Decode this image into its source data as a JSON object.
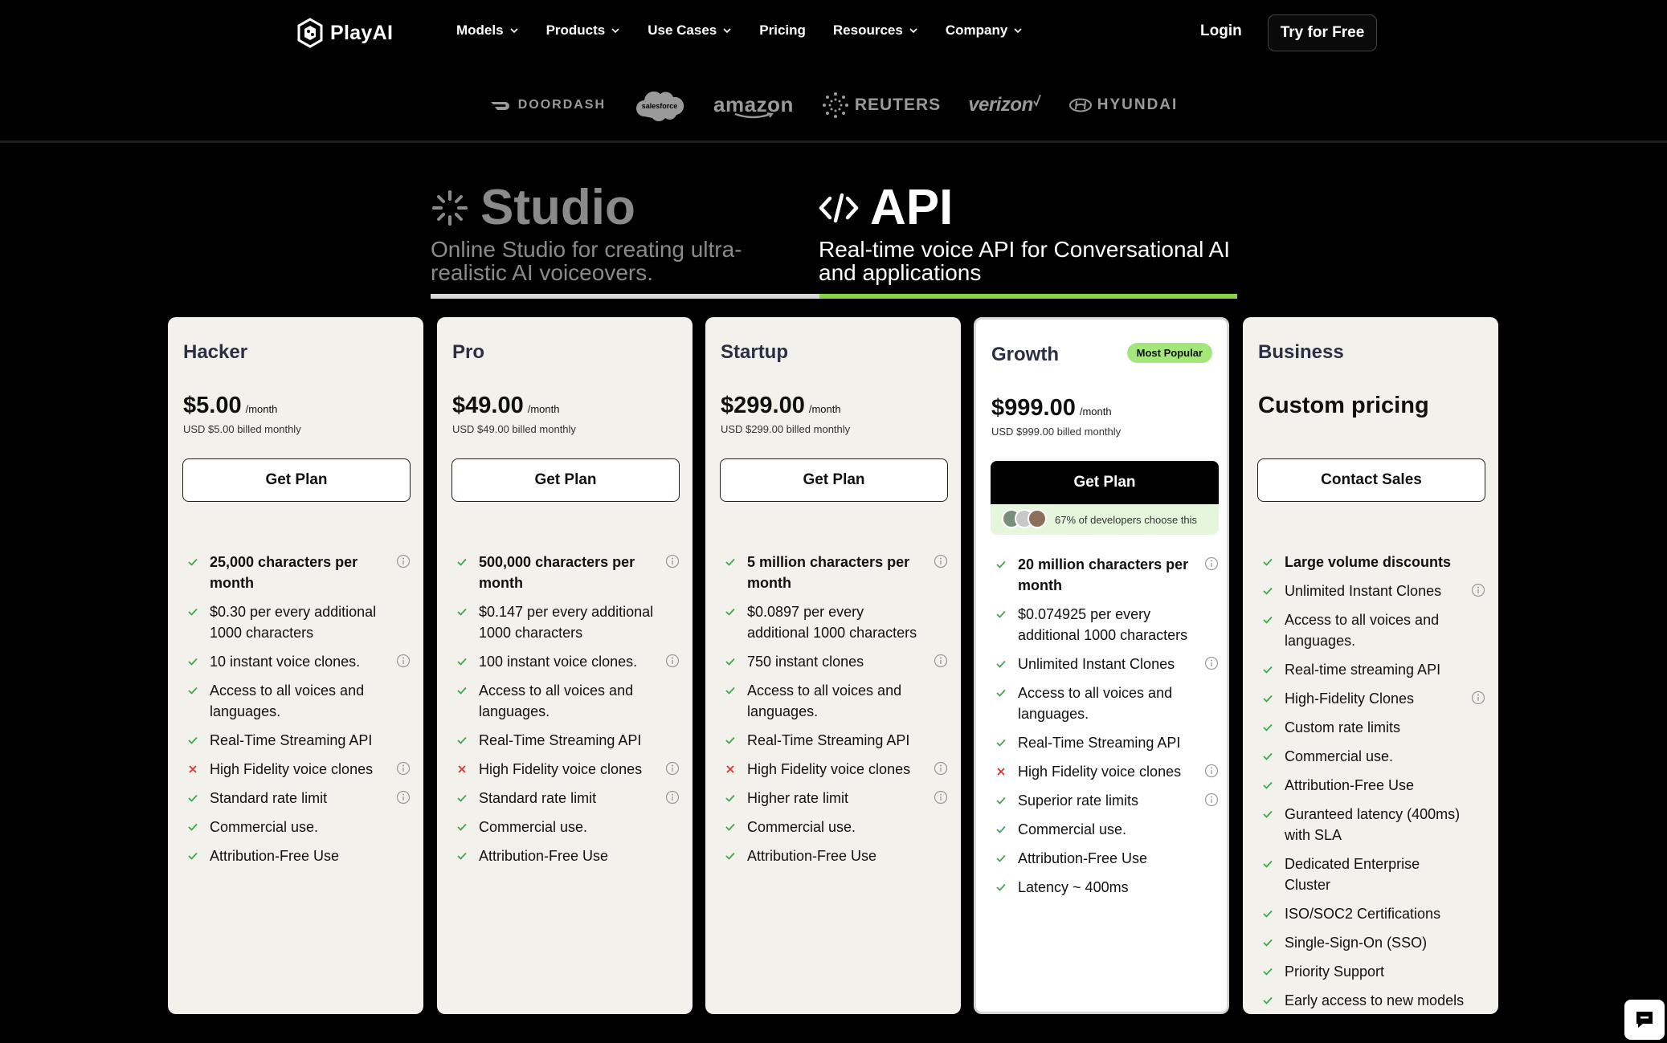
{
  "brand": {
    "name": "PlayAI"
  },
  "nav": {
    "items": [
      {
        "label": "Models",
        "dropdown": true
      },
      {
        "label": "Products",
        "dropdown": true
      },
      {
        "label": "Use Cases",
        "dropdown": true
      },
      {
        "label": "Pricing",
        "dropdown": false
      },
      {
        "label": "Resources",
        "dropdown": true
      },
      {
        "label": "Company",
        "dropdown": true
      }
    ],
    "login": "Login",
    "cta": "Try for Free"
  },
  "logos": {
    "doordash": "DOORDASH",
    "salesforce": "salesforce",
    "amazon": "amazon",
    "reuters": "REUTERS",
    "verizon": "verizon",
    "hyundai": "HYUNDAI"
  },
  "product_tabs": {
    "studio": {
      "title": "Studio",
      "subtitle": "Online Studio for creating ultra-realistic AI voiceovers."
    },
    "api": {
      "title": "API",
      "subtitle": "Real-time voice API for Conversational AI and applications"
    }
  },
  "colors": {
    "accent_green": "#86d34a",
    "badge_green": "#a3e67a",
    "check": "#3ba84a",
    "cross": "#e0322f"
  },
  "plans": [
    {
      "name": "Hacker",
      "price": "$5.00",
      "per": "/month",
      "billed": "USD $5.00 billed monthly",
      "button": "Get Plan",
      "features": [
        {
          "text": "25,000 characters per month",
          "ok": true,
          "info": true,
          "bold": true
        },
        {
          "text": "$0.30 per every additional 1000 characters",
          "ok": true,
          "info": false
        },
        {
          "text": "10 instant voice clones.",
          "ok": true,
          "info": true
        },
        {
          "text": "Access to all voices and languages.",
          "ok": true,
          "info": false
        },
        {
          "text": "Real-Time Streaming API",
          "ok": true,
          "info": false
        },
        {
          "text": "High Fidelity voice clones",
          "ok": false,
          "info": true
        },
        {
          "text": "Standard rate limit",
          "ok": true,
          "info": true
        },
        {
          "text": "Commercial use.",
          "ok": true,
          "info": false
        },
        {
          "text": "Attribution-Free Use",
          "ok": true,
          "info": false
        }
      ]
    },
    {
      "name": "Pro",
      "price": "$49.00",
      "per": "/month",
      "billed": "USD $49.00 billed monthly",
      "button": "Get Plan",
      "features": [
        {
          "text": "500,000 characters per month",
          "ok": true,
          "info": true,
          "bold": true
        },
        {
          "text": "$0.147 per every additional 1000 characters",
          "ok": true,
          "info": false
        },
        {
          "text": "100 instant voice clones.",
          "ok": true,
          "info": true
        },
        {
          "text": "Access to all voices and languages.",
          "ok": true,
          "info": false
        },
        {
          "text": "Real-Time Streaming API",
          "ok": true,
          "info": false
        },
        {
          "text": "High Fidelity voice clones",
          "ok": false,
          "info": true
        },
        {
          "text": "Standard rate limit",
          "ok": true,
          "info": true
        },
        {
          "text": "Commercial use.",
          "ok": true,
          "info": false
        },
        {
          "text": "Attribution-Free Use",
          "ok": true,
          "info": false
        }
      ]
    },
    {
      "name": "Startup",
      "price": "$299.00",
      "per": "/month",
      "billed": "USD $299.00 billed monthly",
      "button": "Get Plan",
      "features": [
        {
          "text": "5 million characters per month",
          "ok": true,
          "info": true,
          "bold": true
        },
        {
          "text": "$0.0897 per every additional 1000 characters",
          "ok": true,
          "info": false
        },
        {
          "text": "750 instant clones",
          "ok": true,
          "info": true
        },
        {
          "text": "Access to all voices and languages.",
          "ok": true,
          "info": false
        },
        {
          "text": "Real-Time Streaming API",
          "ok": true,
          "info": false
        },
        {
          "text": "High Fidelity voice clones",
          "ok": false,
          "info": true
        },
        {
          "text": "Higher rate limit",
          "ok": true,
          "info": true
        },
        {
          "text": "Commercial use.",
          "ok": true,
          "info": false
        },
        {
          "text": "Attribution-Free Use",
          "ok": true,
          "info": false
        }
      ]
    },
    {
      "name": "Growth",
      "badge": "Most Popular",
      "price": "$999.00",
      "per": "/month",
      "billed": "USD $999.00 billed monthly",
      "button": "Get Plan",
      "dev_note": "67% of developers choose this",
      "features": [
        {
          "text": "20 million characters per month",
          "ok": true,
          "info": true,
          "bold": true
        },
        {
          "text": "$0.074925 per every additional 1000 characters",
          "ok": true,
          "info": false
        },
        {
          "text": "Unlimited Instant Clones",
          "ok": true,
          "info": true
        },
        {
          "text": "Access to all voices and languages.",
          "ok": true,
          "info": false
        },
        {
          "text": "Real-Time Streaming API",
          "ok": true,
          "info": false
        },
        {
          "text": "High Fidelity voice clones",
          "ok": false,
          "info": true
        },
        {
          "text": "Superior rate limits",
          "ok": true,
          "info": true
        },
        {
          "text": "Commercial use.",
          "ok": true,
          "info": false
        },
        {
          "text": "Attribution-Free Use",
          "ok": true,
          "info": false
        },
        {
          "text": "Latency ~ 400ms",
          "ok": true,
          "info": false
        }
      ]
    },
    {
      "name": "Business",
      "custom": "Custom pricing",
      "button": "Contact Sales",
      "features": [
        {
          "text": "Large volume discounts",
          "ok": true,
          "info": false,
          "bold": true
        },
        {
          "text": "Unlimited Instant Clones",
          "ok": true,
          "info": true
        },
        {
          "text": "Access to all voices and languages.",
          "ok": true,
          "info": false
        },
        {
          "text": "Real-time streaming API",
          "ok": true,
          "info": false
        },
        {
          "text": "High-Fidelity Clones",
          "ok": true,
          "info": true
        },
        {
          "text": "Custom rate limits",
          "ok": true,
          "info": false
        },
        {
          "text": "Commercial use.",
          "ok": true,
          "info": false
        },
        {
          "text": "Attribution-Free Use",
          "ok": true,
          "info": false
        },
        {
          "text": "Guranteed latency (400ms) with SLA",
          "ok": true,
          "info": false
        },
        {
          "text": "Dedicated Enterprise Cluster",
          "ok": true,
          "info": false
        },
        {
          "text": "ISO/SOC2 Certifications",
          "ok": true,
          "info": false
        },
        {
          "text": "Single-Sign-On (SSO)",
          "ok": true,
          "info": false
        },
        {
          "text": "Priority Support",
          "ok": true,
          "info": false
        },
        {
          "text": "Early access to new models",
          "ok": true,
          "info": false
        }
      ]
    }
  ]
}
